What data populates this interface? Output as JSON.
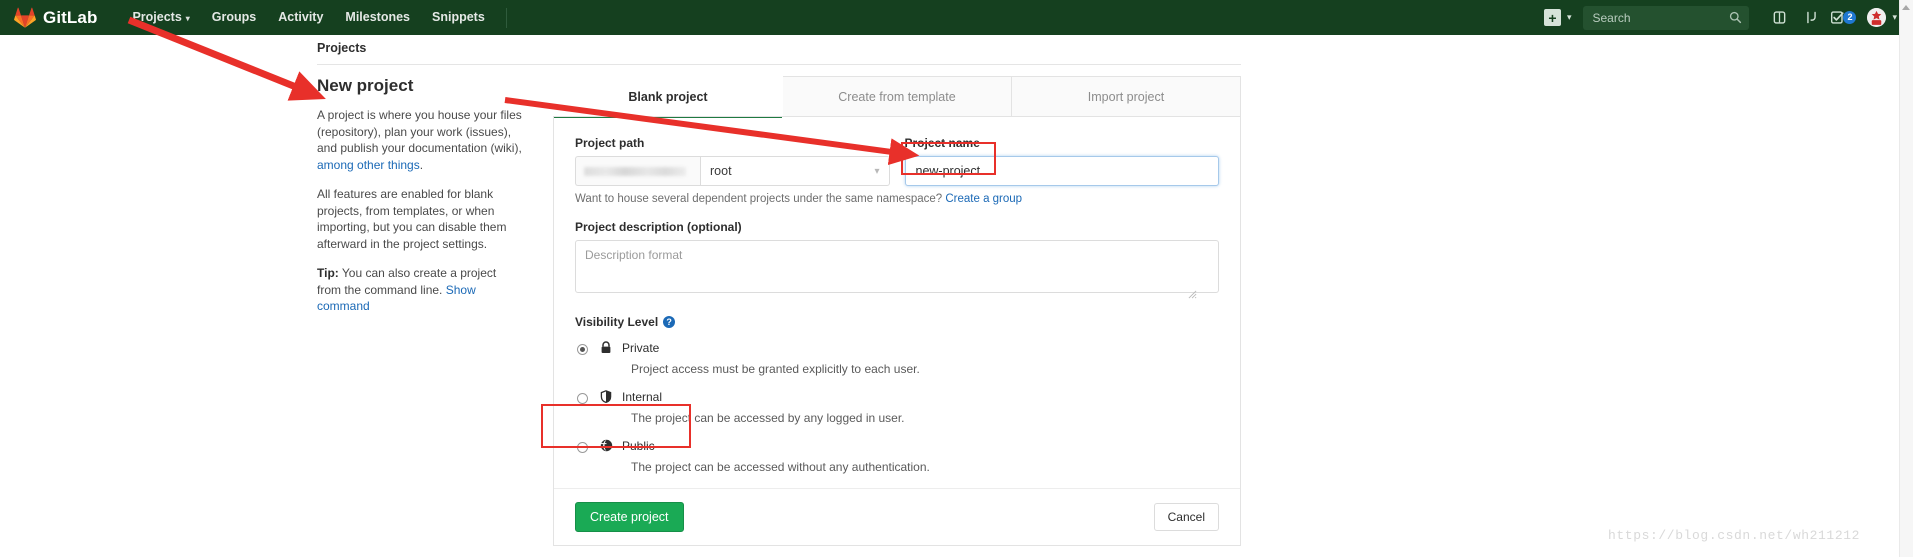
{
  "navbar": {
    "brand": "GitLab",
    "logo_icon": "gitlab-tanuki-icon",
    "links": [
      {
        "label": "Projects",
        "has_caret": true
      },
      {
        "label": "Groups",
        "has_caret": false
      },
      {
        "label": "Activity",
        "has_caret": false
      },
      {
        "label": "Milestones",
        "has_caret": false
      },
      {
        "label": "Snippets",
        "has_caret": false
      }
    ],
    "wrench_icon": "wrench-icon",
    "plus_label": "+",
    "plus_icon": "plus-square-icon",
    "caret_glyph": "⌄",
    "search": {
      "placeholder": "Search",
      "value": "",
      "icon": "search-icon"
    },
    "icons": [
      {
        "name": "issues-icon"
      },
      {
        "name": "merge-requests-icon"
      },
      {
        "name": "todos-icon",
        "badge": "2"
      }
    ],
    "avatar_icon": "user-avatar"
  },
  "breadcrumb": {
    "label": "Projects"
  },
  "left": {
    "title": "New project",
    "p1_a": "A project is where you house your files (repository), plan your work (issues), and publish your documentation (wiki), ",
    "p1_link": "among other things",
    "p1_b": ".",
    "p2": "All features are enabled for blank projects, from templates, or when importing, but you can disable them afterward in the project settings.",
    "tip_label": "Tip:",
    "tip_text": " You can also create a project from the command line. ",
    "tip_link": "Show command"
  },
  "tabs": [
    {
      "label": "Blank project",
      "active": true
    },
    {
      "label": "Create from template",
      "active": false
    },
    {
      "label": "Import project",
      "active": false
    }
  ],
  "form": {
    "project_path_label": "Project path",
    "project_path_namespace": "root",
    "project_path_prefix_redacted": true,
    "project_name_label": "Project name",
    "project_name_value": "new-project",
    "project_name_placeholder": "",
    "namespace_helper_text": "Want to house several dependent projects under the same namespace? ",
    "namespace_helper_link": "Create a group",
    "description_label": "Project description (optional)",
    "description_placeholder": "Description format",
    "description_value": "",
    "visibility_label": "Visibility Level",
    "visibility_help_glyph": "?",
    "visibility_options": [
      {
        "id": "private",
        "label": "Private",
        "icon": "lock-icon",
        "desc": "Project access must be granted explicitly to each user.",
        "selected": true
      },
      {
        "id": "internal",
        "label": "Internal",
        "icon": "shield-icon",
        "desc": "The project can be accessed by any logged in user.",
        "selected": false
      },
      {
        "id": "public",
        "label": "Public",
        "icon": "globe-icon",
        "desc": "The project can be accessed without any authentication.",
        "selected": false
      }
    ],
    "create_button": "Create project",
    "cancel_button": "Cancel"
  },
  "annotations": {
    "watermark": "https://blog.csdn.net/wh211212",
    "color": "#e8302a"
  },
  "colors": {
    "nav_bg": "#15401f",
    "accent_green": "#1aaa55",
    "tab_active_border": "#1f7a41",
    "link_blue": "#1b69b6",
    "badge_blue": "#1f78d1",
    "annotation_red": "#e8302a"
  }
}
